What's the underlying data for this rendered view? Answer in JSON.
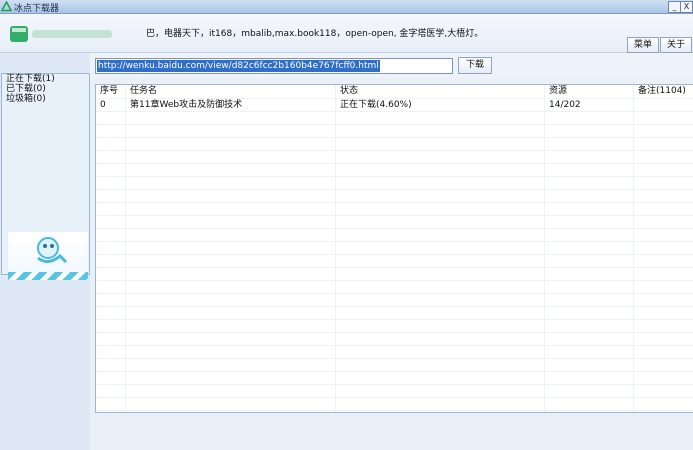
{
  "window": {
    "title": "冰点下载器",
    "minimize_label": "_",
    "close_label": "X"
  },
  "header": {
    "marquee_text": "巴，电器天下，it168，mbalib,max.book118，open-open, 金字塔医学,大梧灯。为支持",
    "menu_button_label": "菜单",
    "about_button_label": "关于"
  },
  "toolbar": {
    "url_value": "http://wenku.baidu.com/view/d82c6fcc2b160b4e767fcff0.html",
    "download_button_label": "下载"
  },
  "sidebar": {
    "items": [
      {
        "label": "正在下载(1)"
      },
      {
        "label": "已下载(0)"
      },
      {
        "label": "垃圾箱(0)"
      }
    ]
  },
  "table": {
    "columns": [
      "序号",
      "任务名",
      "状态",
      "资源",
      "备注(1104)"
    ],
    "rows": [
      {
        "index": "0",
        "task": "第11章Web攻击及防御技术",
        "status": "正在下载(4.60%)",
        "resource": "14/202",
        "note": ""
      }
    ]
  },
  "icons": {
    "app": "app-logo-icon",
    "mascot": "mascot-icon"
  },
  "colors": {
    "accent": "#2f6fc9",
    "brand_green": "#1fa55a",
    "stripe": "#57c6e6"
  }
}
